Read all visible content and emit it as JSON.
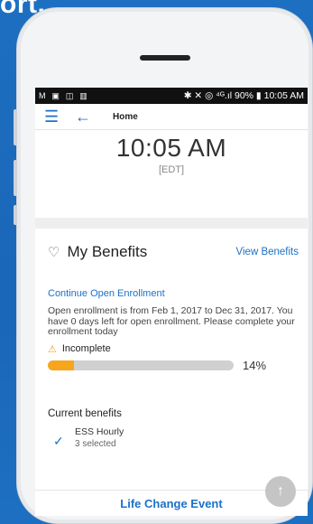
{
  "overlay_text": "ort,",
  "status_bar": {
    "left_icons": [
      "M",
      "▣",
      "◫",
      "▥"
    ],
    "right_text": "✱ ✕ ◎ ⁴ᴳ.ıl 90% ▮ 10:05 AM"
  },
  "appbar": {
    "title": "Home"
  },
  "clock": {
    "time": "10:05 AM",
    "timezone": "[EDT]"
  },
  "benefits": {
    "title": "My Benefits",
    "view_link": "View Benefits",
    "continue_link": "Continue Open Enrollment",
    "description": "Open enrollment is from Feb 1, 2017 to Dec 31, 2017. You have 0 days left for open enrollment. Please complete your enrollment today",
    "status_label": "Incomplete",
    "progress_percent": 14,
    "progress_text": "14%"
  },
  "current_benefits": {
    "title": "Current benefits",
    "items": [
      {
        "name": "ESS Hourly",
        "sub": "3 selected"
      }
    ]
  },
  "footer": {
    "life_change_label": "Life Change Event"
  },
  "colors": {
    "accent": "#1b71c9",
    "progress": "#f7a51a",
    "background": "#1d6fc1"
  }
}
